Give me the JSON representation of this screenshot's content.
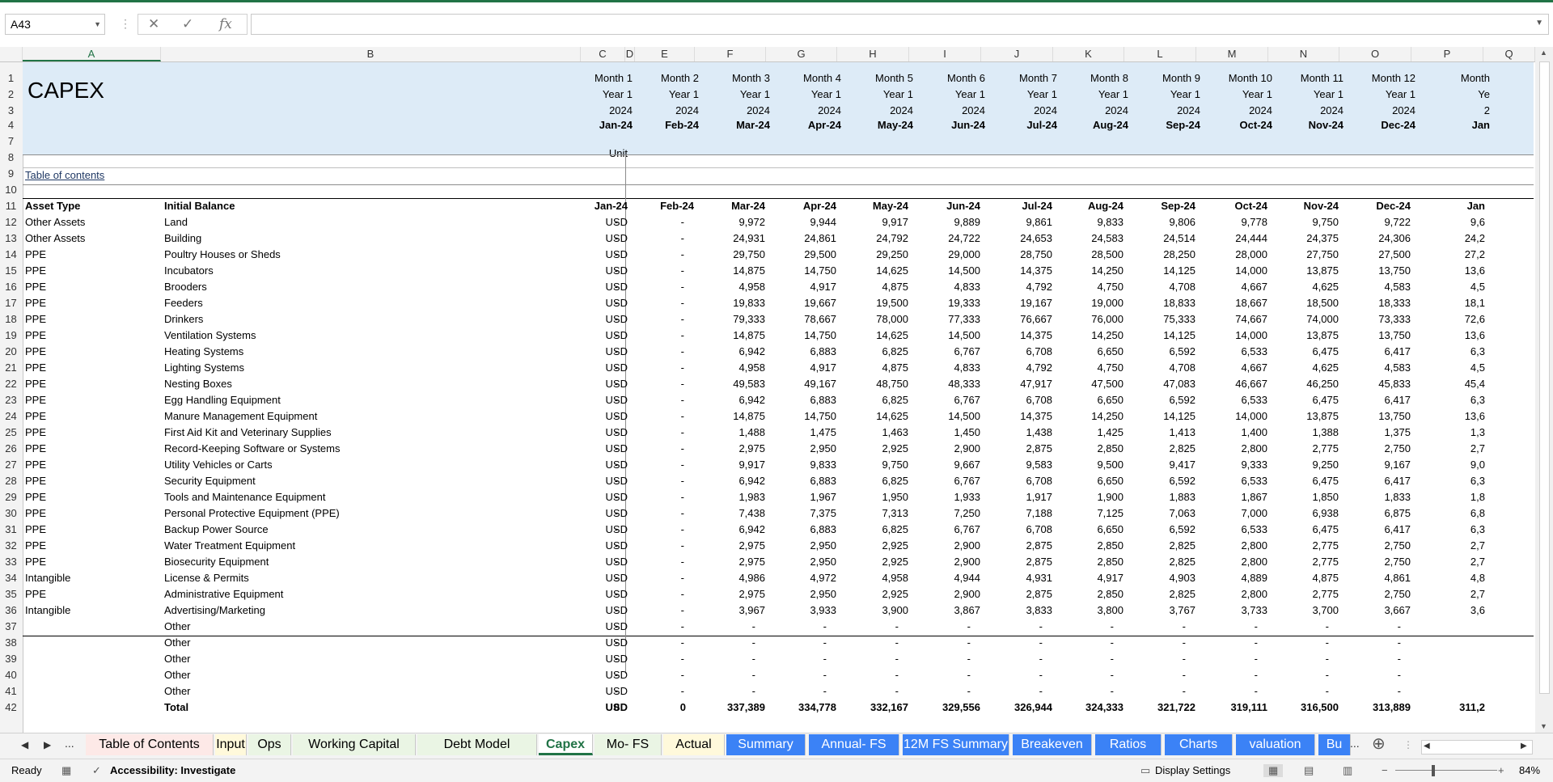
{
  "formula_bar": {
    "name_box": "A43",
    "cancel_glyph": "✕",
    "enter_glyph": "✓",
    "fx_glyph": "fx",
    "formula": ""
  },
  "columns": [
    "A",
    "B",
    "C",
    "D",
    "E",
    "F",
    "G",
    "H",
    "I",
    "J",
    "K",
    "L",
    "M",
    "N",
    "O",
    "P",
    "Q"
  ],
  "rows": [
    "1",
    "2",
    "3",
    "4",
    "7",
    "8",
    "9",
    "10",
    "11",
    "12",
    "13",
    "14",
    "15",
    "16",
    "17",
    "18",
    "19",
    "20",
    "21",
    "22",
    "23",
    "24",
    "25",
    "26",
    "27",
    "28",
    "29",
    "30",
    "31",
    "32",
    "33",
    "34",
    "35",
    "36",
    "37",
    "38",
    "39",
    "40",
    "41",
    "42"
  ],
  "sheet": {
    "title": "CAPEX",
    "unit_label": "Unit",
    "toc_link": "Table of contents",
    "header_asset_type": "Asset Type",
    "header_initial_balance": "Initial Balance",
    "months": [
      "Month 1",
      "Month 2",
      "Month 3",
      "Month 4",
      "Month 5",
      "Month 6",
      "Month 7",
      "Month 8",
      "Month 9",
      "Month 10",
      "Month 11",
      "Month 12",
      "Month"
    ],
    "years": [
      "Year 1",
      "Year 1",
      "Year 1",
      "Year 1",
      "Year 1",
      "Year 1",
      "Year 1",
      "Year 1",
      "Year 1",
      "Year 1",
      "Year 1",
      "Year 1",
      "Ye"
    ],
    "cal_years": [
      "2024",
      "2024",
      "2024",
      "2024",
      "2024",
      "2024",
      "2024",
      "2024",
      "2024",
      "2024",
      "2024",
      "2024",
      "2"
    ],
    "dates": [
      "Jan-24",
      "Feb-24",
      "Mar-24",
      "Apr-24",
      "May-24",
      "Jun-24",
      "Jul-24",
      "Aug-24",
      "Sep-24",
      "Oct-24",
      "Nov-24",
      "Dec-24",
      "Jan"
    ],
    "data_rows": [
      {
        "type": "Other Assets",
        "name": "Land",
        "unit": "USD",
        "values": [
          "-",
          "-",
          "9,972",
          "9,944",
          "9,917",
          "9,889",
          "9,861",
          "9,833",
          "9,806",
          "9,778",
          "9,750",
          "9,722",
          "9,6"
        ]
      },
      {
        "type": "Other Assets",
        "name": "Building",
        "unit": "USD",
        "values": [
          "-",
          "-",
          "24,931",
          "24,861",
          "24,792",
          "24,722",
          "24,653",
          "24,583",
          "24,514",
          "24,444",
          "24,375",
          "24,306",
          "24,2"
        ]
      },
      {
        "type": "PPE",
        "name": "Poultry Houses or Sheds",
        "unit": "USD",
        "values": [
          "-",
          "-",
          "29,750",
          "29,500",
          "29,250",
          "29,000",
          "28,750",
          "28,500",
          "28,250",
          "28,000",
          "27,750",
          "27,500",
          "27,2"
        ]
      },
      {
        "type": "PPE",
        "name": "Incubators",
        "unit": "USD",
        "values": [
          "-",
          "-",
          "14,875",
          "14,750",
          "14,625",
          "14,500",
          "14,375",
          "14,250",
          "14,125",
          "14,000",
          "13,875",
          "13,750",
          "13,6"
        ]
      },
      {
        "type": "PPE",
        "name": "Brooders",
        "unit": "USD",
        "values": [
          "-",
          "-",
          "4,958",
          "4,917",
          "4,875",
          "4,833",
          "4,792",
          "4,750",
          "4,708",
          "4,667",
          "4,625",
          "4,583",
          "4,5"
        ]
      },
      {
        "type": "PPE",
        "name": "Feeders",
        "unit": "USD",
        "values": [
          "-",
          "-",
          "19,833",
          "19,667",
          "19,500",
          "19,333",
          "19,167",
          "19,000",
          "18,833",
          "18,667",
          "18,500",
          "18,333",
          "18,1"
        ]
      },
      {
        "type": "PPE",
        "name": "Drinkers",
        "unit": "USD",
        "values": [
          "-",
          "-",
          "79,333",
          "78,667",
          "78,000",
          "77,333",
          "76,667",
          "76,000",
          "75,333",
          "74,667",
          "74,000",
          "73,333",
          "72,6"
        ]
      },
      {
        "type": "PPE",
        "name": "Ventilation Systems",
        "unit": "USD",
        "values": [
          "-",
          "-",
          "14,875",
          "14,750",
          "14,625",
          "14,500",
          "14,375",
          "14,250",
          "14,125",
          "14,000",
          "13,875",
          "13,750",
          "13,6"
        ]
      },
      {
        "type": "PPE",
        "name": "Heating Systems",
        "unit": "USD",
        "values": [
          "-",
          "-",
          "6,942",
          "6,883",
          "6,825",
          "6,767",
          "6,708",
          "6,650",
          "6,592",
          "6,533",
          "6,475",
          "6,417",
          "6,3"
        ]
      },
      {
        "type": "PPE",
        "name": "Lighting Systems",
        "unit": "USD",
        "values": [
          "-",
          "-",
          "4,958",
          "4,917",
          "4,875",
          "4,833",
          "4,792",
          "4,750",
          "4,708",
          "4,667",
          "4,625",
          "4,583",
          "4,5"
        ]
      },
      {
        "type": "PPE",
        "name": "Nesting Boxes",
        "unit": "USD",
        "values": [
          "-",
          "-",
          "49,583",
          "49,167",
          "48,750",
          "48,333",
          "47,917",
          "47,500",
          "47,083",
          "46,667",
          "46,250",
          "45,833",
          "45,4"
        ]
      },
      {
        "type": "PPE",
        "name": "Egg Handling Equipment",
        "unit": "USD",
        "values": [
          "-",
          "-",
          "6,942",
          "6,883",
          "6,825",
          "6,767",
          "6,708",
          "6,650",
          "6,592",
          "6,533",
          "6,475",
          "6,417",
          "6,3"
        ]
      },
      {
        "type": "PPE",
        "name": "Manure Management Equipment",
        "unit": "USD",
        "values": [
          "-",
          "-",
          "14,875",
          "14,750",
          "14,625",
          "14,500",
          "14,375",
          "14,250",
          "14,125",
          "14,000",
          "13,875",
          "13,750",
          "13,6"
        ]
      },
      {
        "type": "PPE",
        "name": "First Aid Kit and Veterinary Supplies",
        "unit": "USD",
        "values": [
          "-",
          "-",
          "1,488",
          "1,475",
          "1,463",
          "1,450",
          "1,438",
          "1,425",
          "1,413",
          "1,400",
          "1,388",
          "1,375",
          "1,3"
        ]
      },
      {
        "type": "PPE",
        "name": "Record-Keeping Software or Systems",
        "unit": "USD",
        "values": [
          "-",
          "-",
          "2,975",
          "2,950",
          "2,925",
          "2,900",
          "2,875",
          "2,850",
          "2,825",
          "2,800",
          "2,775",
          "2,750",
          "2,7"
        ]
      },
      {
        "type": "PPE",
        "name": "Utility Vehicles or Carts",
        "unit": "USD",
        "values": [
          "-",
          "-",
          "9,917",
          "9,833",
          "9,750",
          "9,667",
          "9,583",
          "9,500",
          "9,417",
          "9,333",
          "9,250",
          "9,167",
          "9,0"
        ]
      },
      {
        "type": "PPE",
        "name": "Security Equipment",
        "unit": "USD",
        "values": [
          "-",
          "-",
          "6,942",
          "6,883",
          "6,825",
          "6,767",
          "6,708",
          "6,650",
          "6,592",
          "6,533",
          "6,475",
          "6,417",
          "6,3"
        ]
      },
      {
        "type": "PPE",
        "name": "Tools and Maintenance Equipment",
        "unit": "USD",
        "values": [
          "-",
          "-",
          "1,983",
          "1,967",
          "1,950",
          "1,933",
          "1,917",
          "1,900",
          "1,883",
          "1,867",
          "1,850",
          "1,833",
          "1,8"
        ]
      },
      {
        "type": "PPE",
        "name": "Personal Protective Equipment (PPE)",
        "unit": "USD",
        "values": [
          "-",
          "-",
          "7,438",
          "7,375",
          "7,313",
          "7,250",
          "7,188",
          "7,125",
          "7,063",
          "7,000",
          "6,938",
          "6,875",
          "6,8"
        ]
      },
      {
        "type": "PPE",
        "name": "Backup Power Source",
        "unit": "USD",
        "values": [
          "-",
          "-",
          "6,942",
          "6,883",
          "6,825",
          "6,767",
          "6,708",
          "6,650",
          "6,592",
          "6,533",
          "6,475",
          "6,417",
          "6,3"
        ]
      },
      {
        "type": "PPE",
        "name": "Water Treatment Equipment",
        "unit": "USD",
        "values": [
          "-",
          "-",
          "2,975",
          "2,950",
          "2,925",
          "2,900",
          "2,875",
          "2,850",
          "2,825",
          "2,800",
          "2,775",
          "2,750",
          "2,7"
        ]
      },
      {
        "type": "PPE",
        "name": "Biosecurity Equipment",
        "unit": "USD",
        "values": [
          "-",
          "-",
          "2,975",
          "2,950",
          "2,925",
          "2,900",
          "2,875",
          "2,850",
          "2,825",
          "2,800",
          "2,775",
          "2,750",
          "2,7"
        ]
      },
      {
        "type": "Intangible",
        "name": "License & Permits",
        "unit": "USD",
        "values": [
          "-",
          "-",
          "4,986",
          "4,972",
          "4,958",
          "4,944",
          "4,931",
          "4,917",
          "4,903",
          "4,889",
          "4,875",
          "4,861",
          "4,8"
        ]
      },
      {
        "type": "PPE",
        "name": "Administrative Equipment",
        "unit": "USD",
        "values": [
          "-",
          "-",
          "2,975",
          "2,950",
          "2,925",
          "2,900",
          "2,875",
          "2,850",
          "2,825",
          "2,800",
          "2,775",
          "2,750",
          "2,7"
        ]
      },
      {
        "type": "Intangible",
        "name": "Advertising/Marketing",
        "unit": "USD",
        "values": [
          "-",
          "-",
          "3,967",
          "3,933",
          "3,900",
          "3,867",
          "3,833",
          "3,800",
          "3,767",
          "3,733",
          "3,700",
          "3,667",
          "3,6"
        ]
      },
      {
        "type": "",
        "name": "Other",
        "unit": "USD",
        "values": [
          "-",
          "-",
          "-",
          "-",
          "-",
          "-",
          "-",
          "-",
          "-",
          "-",
          "-",
          "-",
          ""
        ]
      },
      {
        "type": "",
        "name": "Other",
        "unit": "USD",
        "values": [
          "-",
          "-",
          "-",
          "-",
          "-",
          "-",
          "-",
          "-",
          "-",
          "-",
          "-",
          "-",
          ""
        ]
      },
      {
        "type": "",
        "name": "Other",
        "unit": "USD",
        "values": [
          "-",
          "-",
          "-",
          "-",
          "-",
          "-",
          "-",
          "-",
          "-",
          "-",
          "-",
          "-",
          ""
        ]
      },
      {
        "type": "",
        "name": "Other",
        "unit": "USD",
        "values": [
          "-",
          "-",
          "-",
          "-",
          "-",
          "-",
          "-",
          "-",
          "-",
          "-",
          "-",
          "-",
          ""
        ]
      },
      {
        "type": "",
        "name": "Other",
        "unit": "USD",
        "values": [
          "-",
          "-",
          "-",
          "-",
          "-",
          "-",
          "-",
          "-",
          "-",
          "-",
          "-",
          "-",
          ""
        ]
      }
    ],
    "total": {
      "label": "Total",
      "unit": "USD",
      "values": [
        "0",
        "0",
        "337,389",
        "334,778",
        "332,167",
        "329,556",
        "326,944",
        "324,333",
        "321,722",
        "319,111",
        "316,500",
        "313,889",
        "311,2"
      ]
    }
  },
  "tabs": [
    {
      "label": "Table of Contents",
      "bg": "#fde9e7"
    },
    {
      "label": "Input",
      "bg": "#fff9db"
    },
    {
      "label": "Ops",
      "bg": "#eaf5e4"
    },
    {
      "label": "Working Capital",
      "bg": "#eaf5e4"
    },
    {
      "label": "Debt Model",
      "bg": "#eaf5e4"
    },
    {
      "label": "Capex",
      "bg": "#ffffff"
    },
    {
      "label": "Mo- FS",
      "bg": "#eaf5e4"
    },
    {
      "label": "Actual",
      "bg": "#fff9db"
    },
    {
      "label": "Summary",
      "bg": "#3b82f6"
    },
    {
      "label": "Annual- FS",
      "bg": "#3b82f6"
    },
    {
      "label": "12M FS Summary",
      "bg": "#3b82f6"
    },
    {
      "label": "Breakeven",
      "bg": "#3b82f6"
    },
    {
      "label": "Ratios",
      "bg": "#3b82f6"
    },
    {
      "label": "Charts",
      "bg": "#3b82f6"
    },
    {
      "label": "valuation",
      "bg": "#3b82f6"
    },
    {
      "label": "Bu",
      "bg": "#3b82f6"
    }
  ],
  "tab_nav": {
    "prev": "◀",
    "next": "▶",
    "more": "...",
    "more_right": "...",
    "add": "⊕"
  },
  "status": {
    "ready": "Ready",
    "accessibility": "Accessibility: Investigate",
    "display_settings": "Display Settings",
    "zoom": "84%",
    "zoom_minus": "−",
    "zoom_plus": "+"
  },
  "colors": {
    "excel_green": "#217346",
    "header_band": "#ddebf7",
    "tab_blue": "#3b82f6"
  }
}
